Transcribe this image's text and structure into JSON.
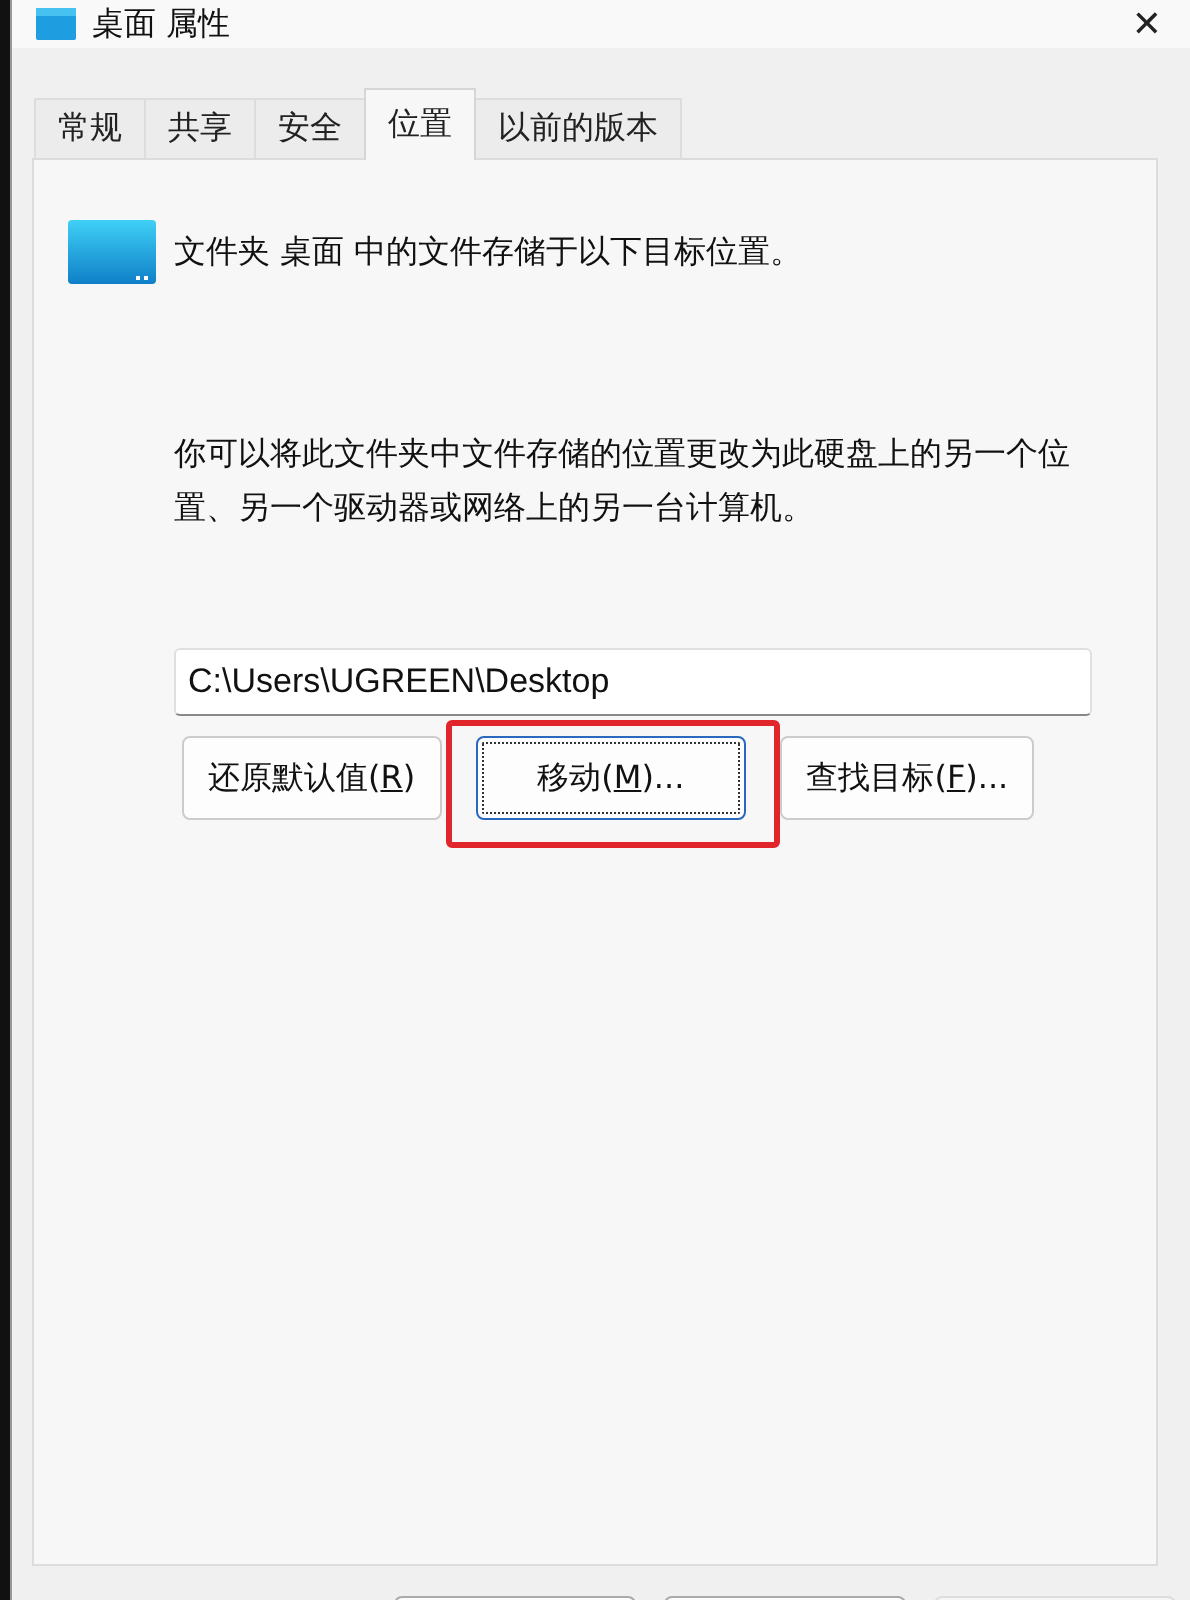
{
  "window": {
    "title": "桌面 属性",
    "close": "✕"
  },
  "tabs": [
    {
      "label": "常规",
      "selected": false
    },
    {
      "label": "共享",
      "selected": false
    },
    {
      "label": "安全",
      "selected": false
    },
    {
      "label": "位置",
      "selected": true
    },
    {
      "label": "以前的版本",
      "selected": false
    }
  ],
  "header_text": "文件夹 桌面 中的文件存储于以下目标位置。",
  "description": "你可以将此文件夹中文件存储的位置更改为此硬盘上的另一个位置、另一个驱动器或网络上的另一台计算机。",
  "path_field": {
    "value": "C:\\Users\\UGREEN\\Desktop"
  },
  "buttons": [
    {
      "before": "还原默认值(",
      "key": "R",
      "after": ")",
      "focused": false,
      "highlighted": false
    },
    {
      "before": "移动(",
      "key": "M",
      "after": ")...",
      "focused": true,
      "highlighted": true
    },
    {
      "before": "查找目标(",
      "key": "F",
      "after": ")...",
      "focused": false,
      "highlighted": false
    }
  ],
  "dialog_buttons": [
    {
      "disabled": false
    },
    {
      "disabled": false
    },
    {
      "disabled": true
    }
  ]
}
